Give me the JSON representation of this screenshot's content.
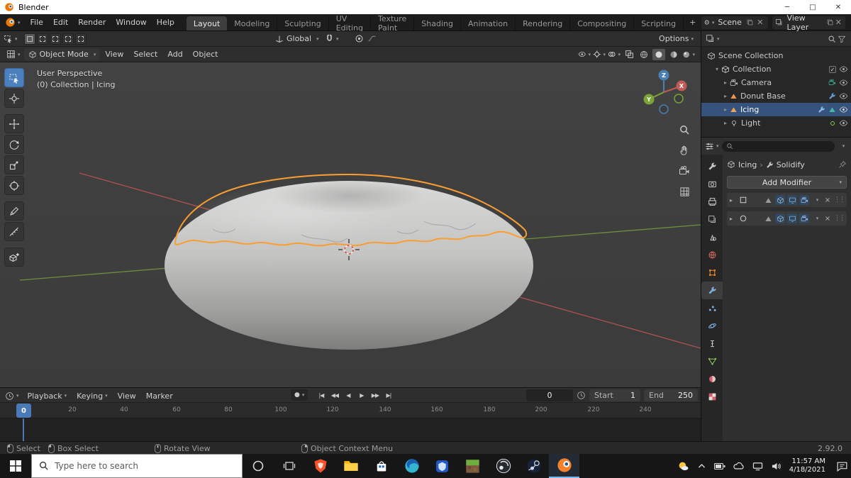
{
  "titlebar": {
    "title": "Blender",
    "controls": {
      "minimize": "─",
      "maximize": "□",
      "close": "✕"
    }
  },
  "topbar": {
    "menus": [
      "File",
      "Edit",
      "Render",
      "Window",
      "Help"
    ],
    "workspaces": [
      "Layout",
      "Modeling",
      "Sculpting",
      "UV Editing",
      "Texture Paint",
      "Shading",
      "Animation",
      "Rendering",
      "Compositing",
      "Scripting"
    ],
    "active_workspace": "Layout",
    "add_workspace": "+",
    "scene": {
      "label": "Scene"
    },
    "view_layer": {
      "label": "View Layer"
    }
  },
  "tool_settings": {
    "orientation": {
      "label": "Global"
    },
    "options": {
      "label": "Options"
    }
  },
  "viewport_header": {
    "mode": {
      "label": "Object Mode"
    },
    "menus": [
      "View",
      "Select",
      "Add",
      "Object"
    ]
  },
  "viewport": {
    "overlay": {
      "line1": "User Perspective",
      "line2": "(0) Collection | Icing"
    },
    "gizmo": {
      "x": "X",
      "y": "Y",
      "z": "Z"
    }
  },
  "outliner": {
    "items": [
      {
        "label": "Scene Collection"
      },
      {
        "label": "Collection"
      },
      {
        "label": "Camera"
      },
      {
        "label": "Donut Base"
      },
      {
        "label": "Icing"
      },
      {
        "label": "Light"
      }
    ],
    "selected_item": "Icing"
  },
  "properties": {
    "breadcrumb": {
      "object": "Icing",
      "separator": "›",
      "modifier": "Solidify"
    },
    "add_modifier": {
      "label": "Add Modifier"
    },
    "active_tab": "modifier-properties"
  },
  "timeline": {
    "menus": [
      "Playback",
      "Keying",
      "View",
      "Marker"
    ],
    "current_frame": "0",
    "playhead": {
      "frame": "0"
    },
    "range": {
      "start_label": "Start",
      "start_value": "1",
      "end_label": "End",
      "end_value": "250"
    },
    "ticks": [
      "0",
      "20",
      "40",
      "60",
      "80",
      "100",
      "120",
      "140",
      "160",
      "180",
      "200",
      "220",
      "240"
    ]
  },
  "statusbar": {
    "hints": [
      {
        "label": "Select"
      },
      {
        "label": "Box Select"
      },
      {
        "label": "Rotate View"
      },
      {
        "label": "Object Context Menu"
      }
    ],
    "version": "2.92.0"
  },
  "taskbar": {
    "search": {
      "placeholder": "Type here to search"
    },
    "clock": {
      "time": "11:57 AM",
      "date": "4/18/2021"
    }
  },
  "colors": {
    "accent_blue": "#4772b3",
    "selection_orange": "#fa9e32",
    "blender_orange": "#ea7600"
  }
}
